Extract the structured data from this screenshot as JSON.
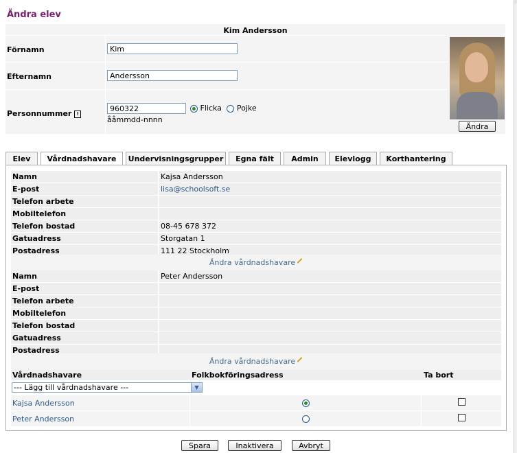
{
  "page_title": "Ändra elev",
  "student": {
    "name_heading": "Kim Andersson",
    "firstname_label": "Förnamn",
    "firstname_value": "Kim",
    "lastname_label": "Efternamn",
    "lastname_value": "Andersson",
    "personnummer_label": "Personnummer",
    "personnummer_value": "960322",
    "personnummer_hint": "ååmmdd-nnnn",
    "gender_options": [
      "Flicka",
      "Pojke"
    ],
    "gender_selected": "Flicka",
    "photo_button": "Ändra"
  },
  "tabs": [
    {
      "label": "Elev",
      "active": false
    },
    {
      "label": "Vårdnadshavare",
      "active": true
    },
    {
      "label": "Undervisningsgrupper",
      "active": false
    },
    {
      "label": "Egna fält",
      "active": false
    },
    {
      "label": "Admin",
      "active": false
    },
    {
      "label": "Elevlogg",
      "active": false
    },
    {
      "label": "Korthantering",
      "active": false
    }
  ],
  "guardians": [
    {
      "rows": [
        {
          "label": "Namn",
          "value": "Kajsa Andersson"
        },
        {
          "label": "E-post",
          "value": "lisa@schoolsoft.se"
        },
        {
          "label": "Telefon arbete",
          "value": ""
        },
        {
          "label": "Mobiltelefon",
          "value": ""
        },
        {
          "label": "Telefon bostad",
          "value": "08-45 678 372"
        },
        {
          "label": "Gatuadress",
          "value": "Storgatan 1"
        },
        {
          "label": "Postadress",
          "value": "111 22 Stockholm"
        }
      ],
      "edit_link": "Ändra vårdnadshavare"
    },
    {
      "rows": [
        {
          "label": "Namn",
          "value": "Peter Andersson"
        },
        {
          "label": "E-post",
          "value": ""
        },
        {
          "label": "Telefon arbete",
          "value": ""
        },
        {
          "label": "Mobiltelefon",
          "value": ""
        },
        {
          "label": "Telefon bostad",
          "value": ""
        },
        {
          "label": "Gatuadress",
          "value": ""
        },
        {
          "label": "Postadress",
          "value": ""
        }
      ],
      "edit_link": "Ändra vårdnadshavare"
    }
  ],
  "guardian_table": {
    "headers": [
      "Vårdnadshavare",
      "Folkbokföringsadress",
      "Ta bort"
    ],
    "add_select": "--- Lägg till vårdnadshavare ---",
    "rows": [
      {
        "name": "Kajsa Andersson",
        "folkbok": true,
        "remove": false
      },
      {
        "name": "Peter Andersson",
        "folkbok": false,
        "remove": false
      }
    ]
  },
  "actions": {
    "save": "Spara",
    "deactivate": "Inaktivera",
    "cancel": "Avbryt"
  },
  "colors": {
    "title": "#7a1f6e",
    "link": "#2b5a8a",
    "row_bg": "#eeeeee"
  }
}
